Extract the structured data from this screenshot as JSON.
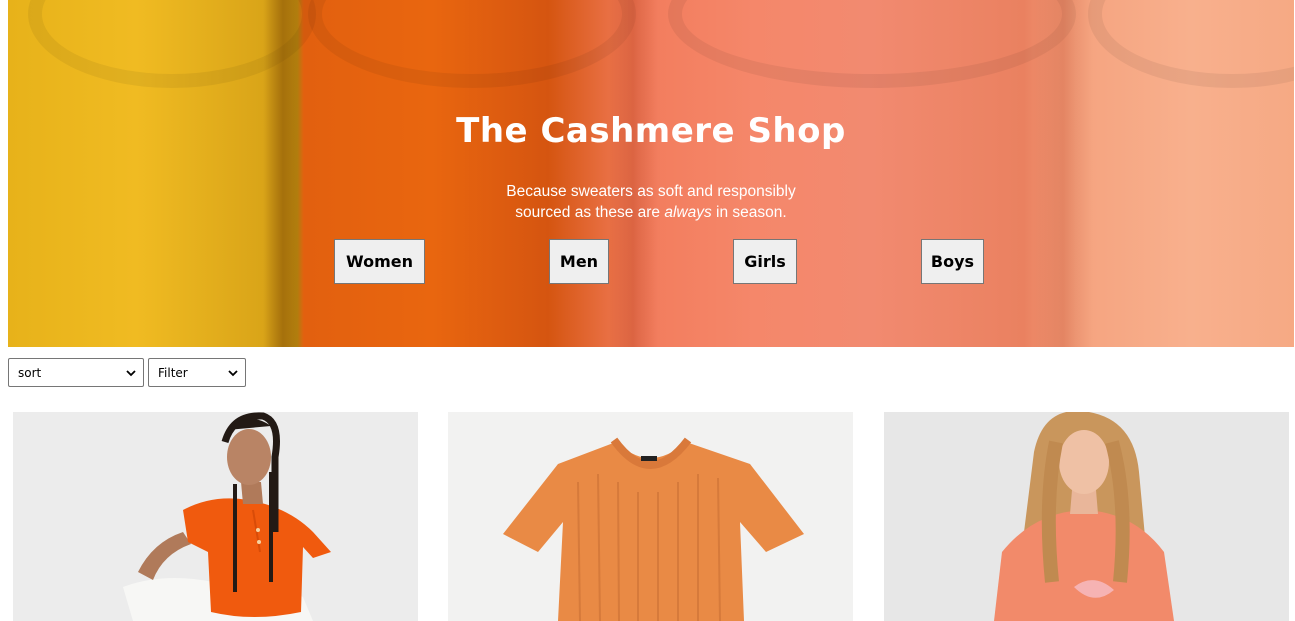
{
  "hero": {
    "title": "The Cashmere Shop",
    "subtitle_line1": "Because sweaters as soft and responsibly",
    "subtitle_line2_pre": "sourced as these are ",
    "subtitle_line2_em": "always",
    "subtitle_line2_post": " in season.",
    "categories": [
      {
        "label": "Women"
      },
      {
        "label": "Men"
      },
      {
        "label": "Girls"
      },
      {
        "label": "Boys"
      }
    ]
  },
  "controls": {
    "sort": {
      "selected": "sort"
    },
    "filter": {
      "selected": "Filter"
    }
  },
  "products": [
    {
      "image": "model-orange-polo-sweater"
    },
    {
      "image": "orange-ribbed-tee-sweater"
    },
    {
      "image": "model-coral-crewneck-sweater"
    }
  ],
  "colors": {
    "button_bg": "#efefef",
    "border": "#767676",
    "hero_text": "#ffffff"
  }
}
